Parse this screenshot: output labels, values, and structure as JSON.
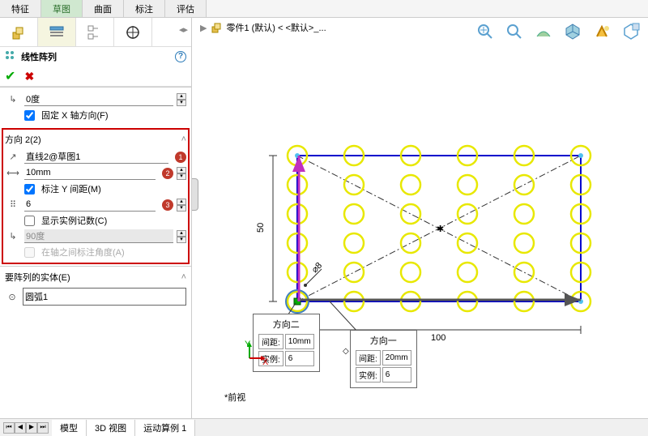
{
  "tabs": {
    "items": [
      "特征",
      "草图",
      "曲面",
      "标注",
      "评估"
    ],
    "active": 1
  },
  "crumb": {
    "part": "零件1 (默认) < <默认>_..."
  },
  "pm": {
    "title": "线性阵列",
    "dir1": {
      "angle": "0度",
      "fixx": "固定 X 轴方向(F)"
    },
    "dir2": {
      "header": "方向 2(2)",
      "ref": "直线2@草图1",
      "badge1": "1",
      "dist": "10mm",
      "badge2": "2",
      "mark": "标注 Y 间距(M)",
      "count": "6",
      "badge3": "3",
      "showcount": "显示实例记数(C)",
      "angle": "90度",
      "markangle": "在轴之间标注角度(A)"
    },
    "entities": {
      "header": "要阵列的实体(E)",
      "item": "圆弧1"
    }
  },
  "viewport": {
    "dim_w": "100",
    "dim_h": "50",
    "dim_d": "8",
    "front": "前视",
    "box1": {
      "title": "方向二",
      "spacing_l": "间距:",
      "spacing_v": "10mm",
      "inst_l": "实例:",
      "inst_v": "6"
    },
    "box2": {
      "title": "方向一",
      "spacing_l": "间距:",
      "spacing_v": "20mm",
      "inst_l": "实例:",
      "inst_v": "6"
    }
  },
  "bottomtabs": [
    "模型",
    "3D 视图",
    "运动算例 1"
  ]
}
